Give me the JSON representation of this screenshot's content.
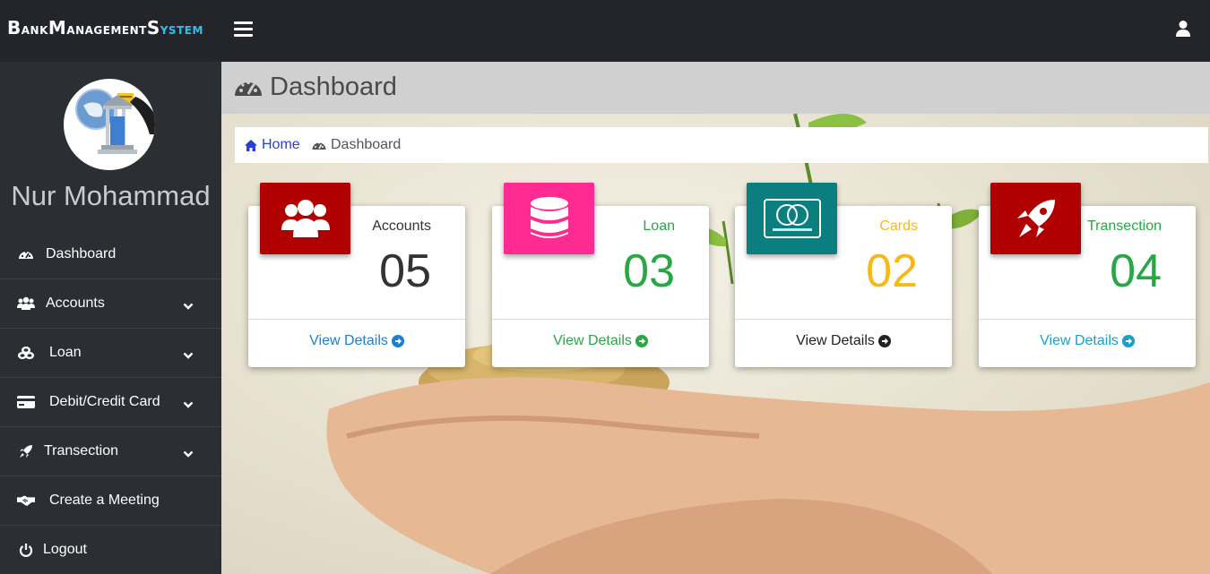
{
  "app": {
    "brand_parts": [
      "Bank",
      "Management",
      "System"
    ]
  },
  "profile": {
    "name": "Nur Mohammad"
  },
  "sidebar": {
    "items": [
      {
        "label": "Dashboard",
        "icon": "dashboard-icon",
        "has_submenu": false
      },
      {
        "label": "Accounts",
        "icon": "users-icon",
        "has_submenu": true
      },
      {
        "label": "Loan",
        "icon": "coins-icon",
        "has_submenu": true
      },
      {
        "label": "Debit/Credit Card",
        "icon": "credit-card-icon",
        "has_submenu": true
      },
      {
        "label": "Transection",
        "icon": "rocket-icon",
        "has_submenu": true
      },
      {
        "label": "Create a Meeting",
        "icon": "handshake-icon",
        "has_submenu": false
      },
      {
        "label": "Logout",
        "icon": "power-icon",
        "has_submenu": false
      }
    ]
  },
  "page": {
    "title": "Dashboard"
  },
  "breadcrumb": {
    "home": "Home",
    "current": "Dashboard"
  },
  "cards": [
    {
      "label": "Accounts",
      "count": "05",
      "link": "View Details",
      "icon": "users-icon",
      "icon_bg": "#b00000",
      "label_color": "#333333",
      "count_color": "#333333",
      "link_color": "#1a7fd6"
    },
    {
      "label": "Loan",
      "count": "03",
      "link": "View Details",
      "icon": "database-icon",
      "icon_bg": "#ff2a92",
      "label_color": "#28a745",
      "count_color": "#28a745",
      "link_color": "#28a745"
    },
    {
      "label": "Cards",
      "count": "02",
      "link": "View Details",
      "icon": "mastercard-icon",
      "icon_bg": "#0b7f7f",
      "label_color": "#f6b91a",
      "count_color": "#f6b91a",
      "link_color": "#222222"
    },
    {
      "label": "Transection",
      "count": "04",
      "link": "View Details",
      "icon": "rocket-icon",
      "icon_bg": "#b00000",
      "label_color": "#28a745",
      "count_color": "#28a745",
      "link_color": "#1aa0c8"
    }
  ],
  "colors": {
    "topbar": "#23252b",
    "sidebar": "#2b2e33",
    "header": "#d0d0d0",
    "accent_blue": "#2ec1f0"
  }
}
